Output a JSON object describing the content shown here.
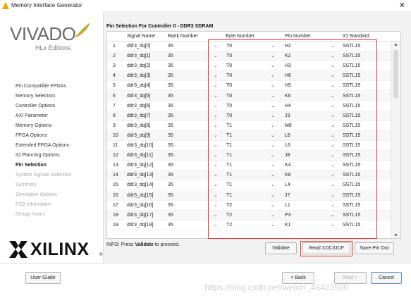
{
  "window": {
    "title": "Memory Interface Generator",
    "close_glyph": "✕"
  },
  "logo": {
    "brand": "VIVADO",
    "edition": "HLx Editions"
  },
  "sidebar": {
    "items": [
      {
        "label": "Pin Compatible FPGAs",
        "state": "normal"
      },
      {
        "label": "Memory Selection",
        "state": "normal"
      },
      {
        "label": "Controller Options",
        "state": "normal"
      },
      {
        "label": "AXI Parameter",
        "state": "normal"
      },
      {
        "label": "Memory Options",
        "state": "normal"
      },
      {
        "label": "FPGA Options",
        "state": "normal"
      },
      {
        "label": "Extended FPGA Options",
        "state": "normal"
      },
      {
        "label": "IO Planning Options",
        "state": "normal"
      },
      {
        "label": "Pin Selection",
        "state": "active"
      },
      {
        "label": "System Signals Selection",
        "state": "disabled"
      },
      {
        "label": "Summary",
        "state": "disabled"
      },
      {
        "label": "Simulation Options",
        "state": "disabled"
      },
      {
        "label": "PCB information",
        "state": "disabled"
      },
      {
        "label": "Design Notes",
        "state": "disabled"
      }
    ]
  },
  "xilinx": {
    "brand": "XILINX",
    "reg": "®"
  },
  "main": {
    "section_title": "Pin Selection For Controller 0 - DDR3 SDRAM",
    "columns": [
      "",
      "Signal Name",
      "Bank Number",
      "Byte Number",
      "Pin Number",
      "IO Standard"
    ],
    "rows": [
      {
        "n": "1",
        "signal": "ddr3_dq[0]",
        "bank": "35",
        "byte": "T0",
        "pin": "H2",
        "io": "SSTL15"
      },
      {
        "n": "2",
        "signal": "ddr3_dq[1]",
        "bank": "35",
        "byte": "T0",
        "pin": "K2",
        "io": "SSTL15"
      },
      {
        "n": "3",
        "signal": "ddr3_dq[2]",
        "bank": "35",
        "byte": "T0",
        "pin": "H3",
        "io": "SSTL15"
      },
      {
        "n": "4",
        "signal": "ddr3_dq[3]",
        "bank": "35",
        "byte": "T0",
        "pin": "H6",
        "io": "SSTL15"
      },
      {
        "n": "5",
        "signal": "ddr3_dq[4]",
        "bank": "35",
        "byte": "T0",
        "pin": "H5",
        "io": "SSTL15"
      },
      {
        "n": "6",
        "signal": "ddr3_dq[5]",
        "bank": "35",
        "byte": "T0",
        "pin": "K6",
        "io": "SSTL15"
      },
      {
        "n": "7",
        "signal": "ddr3_dq[6]",
        "bank": "35",
        "byte": "T0",
        "pin": "H4",
        "io": "SSTL15"
      },
      {
        "n": "8",
        "signal": "ddr3_dq[7]",
        "bank": "35",
        "byte": "T0",
        "pin": "J3",
        "io": "SSTL15"
      },
      {
        "n": "9",
        "signal": "ddr3_dq[8]",
        "bank": "35",
        "byte": "T1",
        "pin": "M8",
        "io": "SSTL15"
      },
      {
        "n": "10",
        "signal": "ddr3_dq[9]",
        "bank": "35",
        "byte": "T1",
        "pin": "L8",
        "io": "SSTL15"
      },
      {
        "n": "11",
        "signal": "ddr3_dq[10]",
        "bank": "35",
        "byte": "T1",
        "pin": "L6",
        "io": "SSTL15"
      },
      {
        "n": "12",
        "signal": "ddr3_dq[11]",
        "bank": "35",
        "byte": "T1",
        "pin": "J8",
        "io": "SSTL15"
      },
      {
        "n": "13",
        "signal": "ddr3_dq[12]",
        "bank": "35",
        "byte": "T1",
        "pin": "K4",
        "io": "SSTL15"
      },
      {
        "n": "14",
        "signal": "ddr3_dq[13]",
        "bank": "35",
        "byte": "T1",
        "pin": "K8",
        "io": "SSTL15"
      },
      {
        "n": "15",
        "signal": "ddr3_dq[14]",
        "bank": "35",
        "byte": "T1",
        "pin": "L4",
        "io": "SSTL15"
      },
      {
        "n": "16",
        "signal": "ddr3_dq[15]",
        "bank": "35",
        "byte": "T1",
        "pin": "J7",
        "io": "SSTL15"
      },
      {
        "n": "17",
        "signal": "ddr3_dq[16]",
        "bank": "35",
        "byte": "T2",
        "pin": "L1",
        "io": "SSTL15"
      },
      {
        "n": "18",
        "signal": "ddr3_dq[17]",
        "bank": "35",
        "byte": "T2",
        "pin": "P3",
        "io": "SSTL15"
      },
      {
        "n": "19",
        "signal": "ddr3_dq[18]",
        "bank": "35",
        "byte": "T2",
        "pin": "K1",
        "io": "SSTL15"
      }
    ],
    "info_prefix": "INFO: Press ",
    "info_bold": "Validate",
    "info_suffix": " to proceed.",
    "buttons": {
      "validate": "Validate",
      "read": "Read XDC/UCF",
      "save": "Save Pin Out"
    }
  },
  "footer": {
    "user_guide": "User Guide",
    "back": "< Back",
    "next": "Next >",
    "cancel": "Cancel",
    "watermark": "https://blog.csdn.net/weixin_46423500"
  },
  "colors": {
    "highlight_box": "#e53935",
    "primary_border": "#5a8fd8"
  }
}
